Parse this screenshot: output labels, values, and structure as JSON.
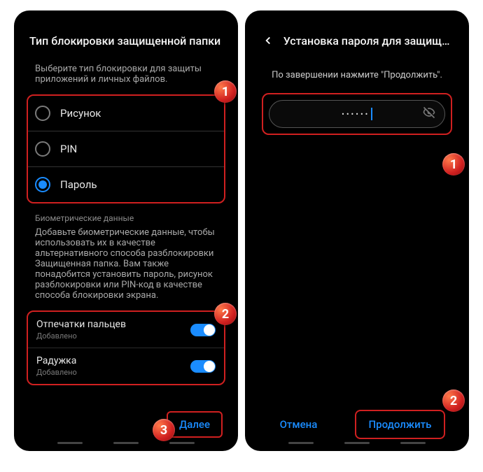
{
  "p1": {
    "title": "Тип блокировки защищенной папки",
    "helper": "Выберите тип блокировки для защиты приложений и личных файлов.",
    "opts": [
      "Рисунок",
      "PIN",
      "Пароль"
    ],
    "section": "Биометрические данные",
    "bio_helper": "Добавьте биометрические данные, чтобы использовать их в качестве альтернативного способа разблокировки Защищенная папка. Вам также понадобится установить пароль, рисунок разблокировки или PIN-код в качестве способа блокировки экрана.",
    "b1": {
      "t": "Отпечатки пальцев",
      "s": "Добавлено"
    },
    "b2": {
      "t": "Радужка",
      "s": "Добавлено"
    },
    "next": "Далее"
  },
  "p2": {
    "title": "Установка пароля для защищен...",
    "helper": "По завершении нажмите \"Продолжить\".",
    "pw": "••••••",
    "cancel": "Отмена",
    "cont": "Продолжить"
  }
}
